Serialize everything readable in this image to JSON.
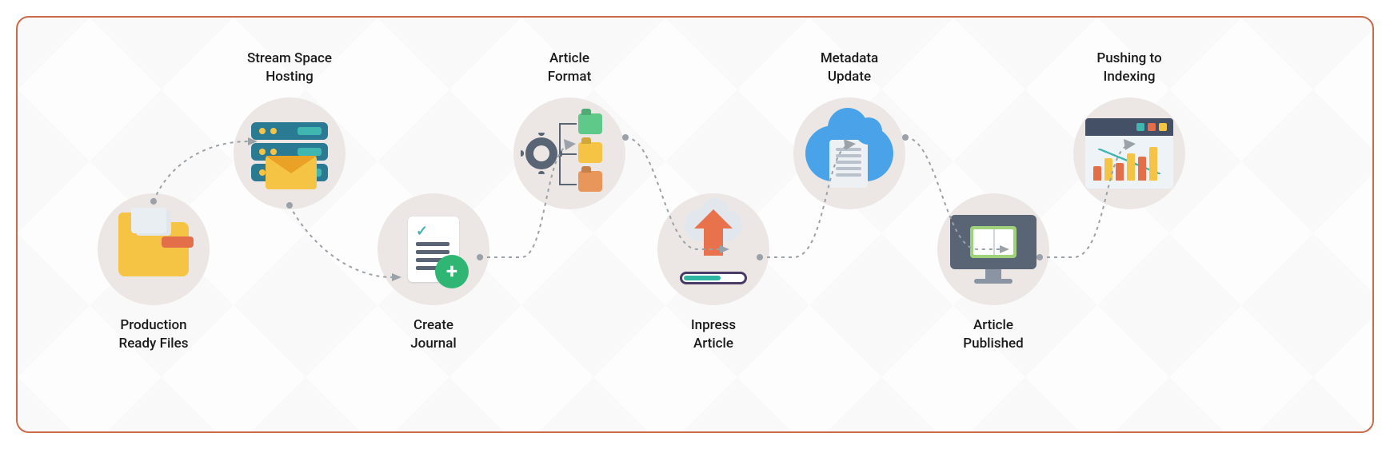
{
  "steps": {
    "production_ready_files": "Production\nReady Files",
    "stream_space_hosting": "Stream Space\nHosting",
    "create_journal": "Create\nJournal",
    "article_format": "Article\nFormat",
    "inpress_article": "Inpress\nArticle",
    "metadata_update": "Metadata\nUpdate",
    "article_published": "Article\nPublished",
    "pushing_to_indexing": "Pushing to\nIndexing"
  }
}
